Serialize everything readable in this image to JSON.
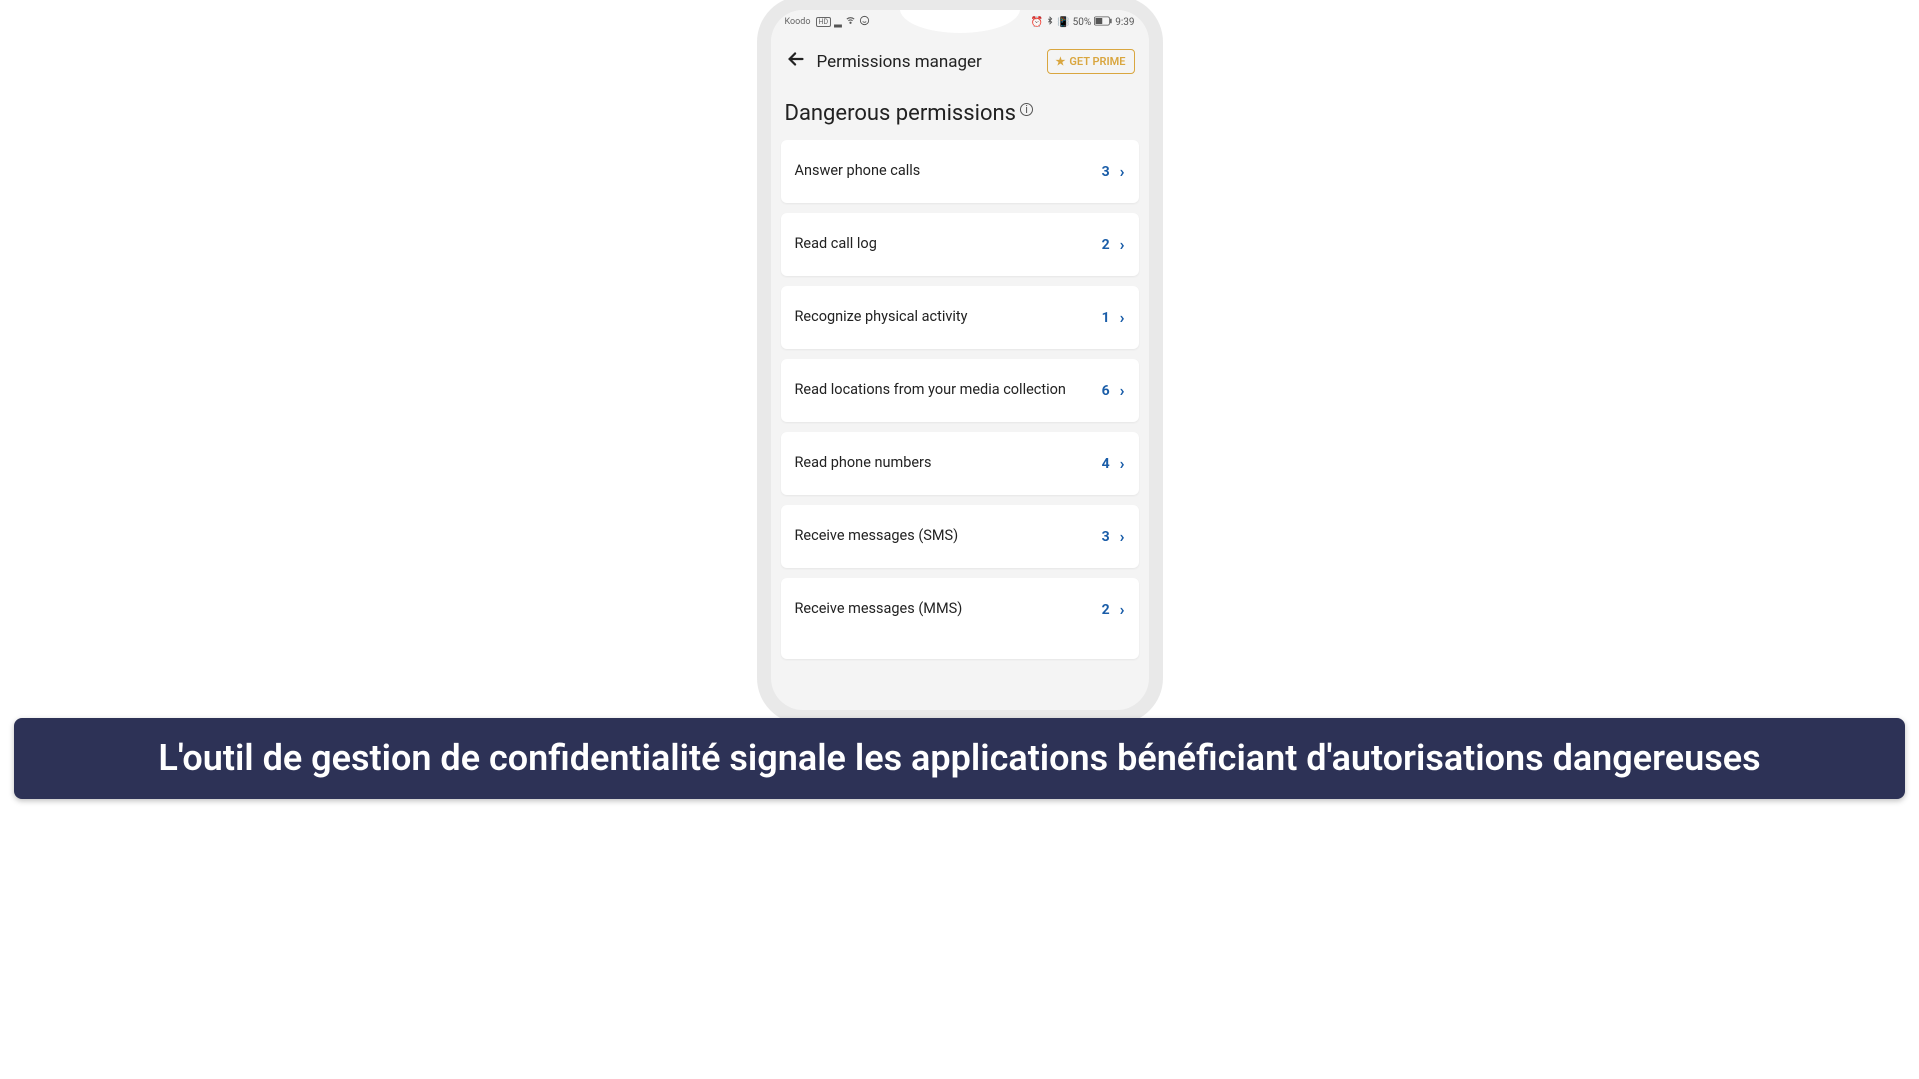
{
  "status": {
    "carrier": "Koodo",
    "hd": "HD",
    "battery_text": "50%",
    "time": "9:39"
  },
  "header": {
    "title": "Permissions manager",
    "prime_label": "GET PRIME"
  },
  "section": {
    "title": "Dangerous permissions"
  },
  "permissions": [
    {
      "label": "Answer phone calls",
      "count": "3"
    },
    {
      "label": "Read call log",
      "count": "2"
    },
    {
      "label": "Recognize physical activity",
      "count": "1"
    },
    {
      "label": "Read locations from your media collection",
      "count": "6"
    },
    {
      "label": "Read phone numbers",
      "count": "4"
    },
    {
      "label": "Receive messages (SMS)",
      "count": "3"
    },
    {
      "label": "Receive messages (MMS)",
      "count": "2"
    }
  ],
  "caption": "L'outil de gestion de confidentialité signale les applications bénéficiant d'autorisations dangereuses"
}
